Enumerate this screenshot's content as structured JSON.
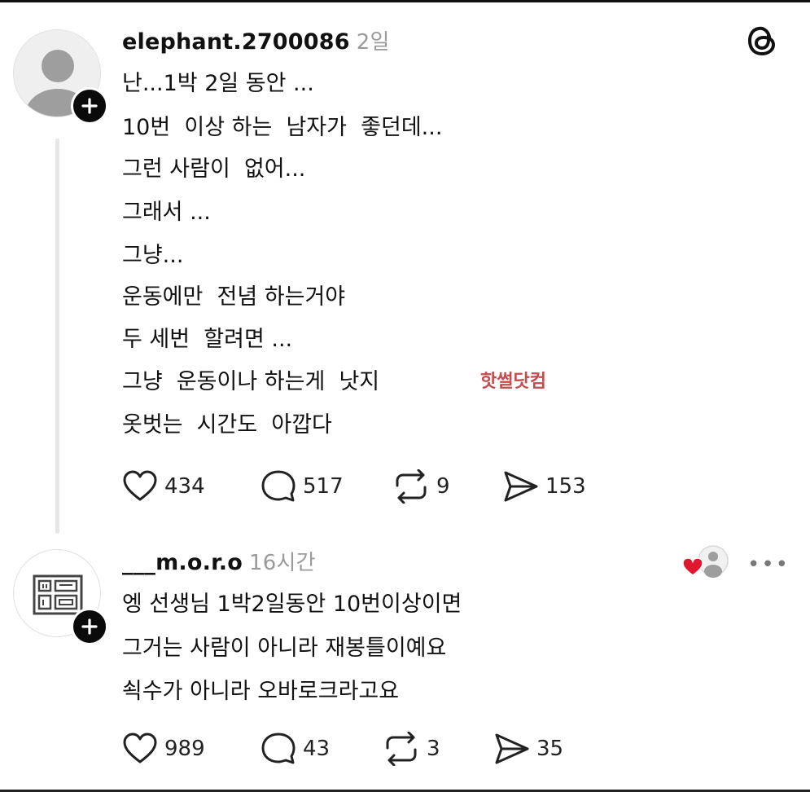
{
  "post": {
    "username": "elephant.2700086",
    "time": "2일",
    "lines": [
      "난...1박 2일 동안 ...",
      "10번  이상 하는  남자가  좋던데...",
      "그런 사람이  없어...",
      "그래서 ...",
      "그냥...",
      "운동에만  전념 하는거야",
      "두 세번  할려면 ...",
      "그냥  운동이나 하는게  낫지",
      "옷벗는  시간도  아깝다"
    ],
    "stats": {
      "likes": "434",
      "replies": "517",
      "reposts": "9",
      "shares": "153"
    }
  },
  "reply": {
    "username": "___m.o.r.o",
    "time": "16시간",
    "lines": [
      "엥 선생님 1박2일동안 10번이상이면",
      "그거는 사람이 아니라 재봉틀이예요",
      "쇡수가 아니라 오바로크라고요"
    ],
    "stats": {
      "likes": "989",
      "replies": "43",
      "reposts": "3",
      "shares": "35"
    }
  },
  "watermark": "핫썰닷컴",
  "icons": {
    "threads_logo": "threads-logo-icon",
    "heart": "heart-icon",
    "comment": "comment-icon",
    "repost": "repost-icon",
    "share": "share-icon",
    "more": "more-icon"
  }
}
